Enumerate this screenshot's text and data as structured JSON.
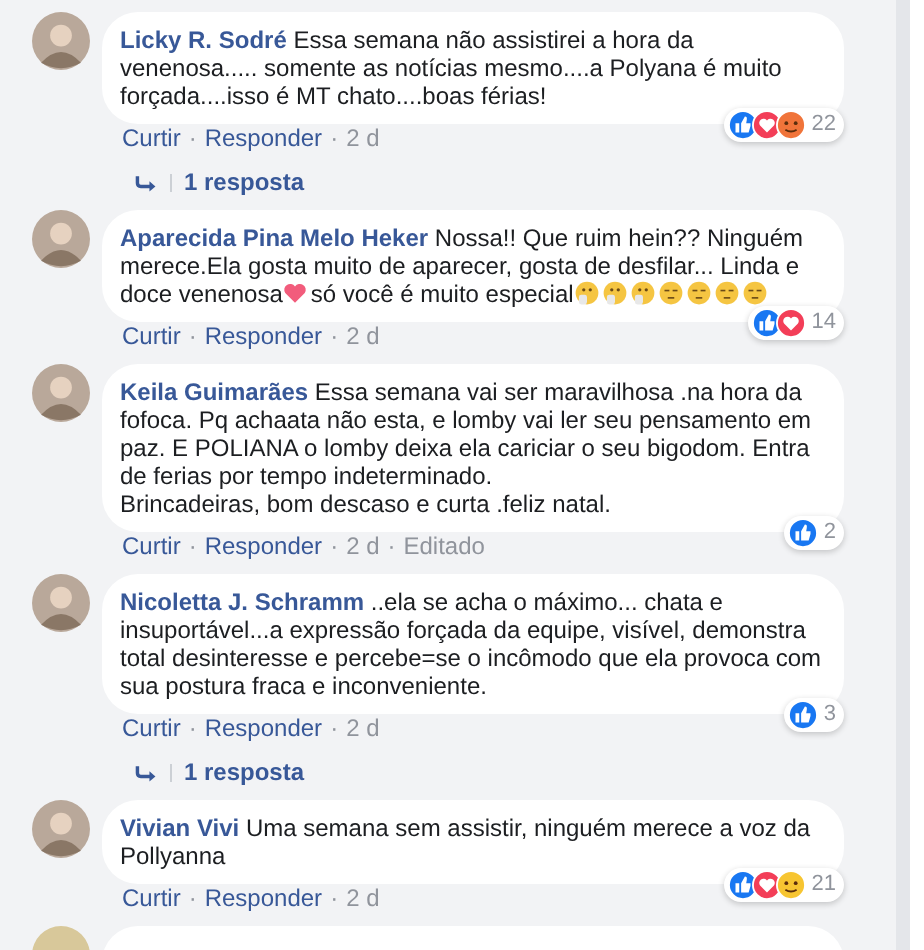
{
  "comments": [
    {
      "kind": "comment",
      "author": "Licky R. Sodré",
      "body": [
        {
          "kind": "text",
          "text": "Essa semana não assistirei a hora da venenosa..... somente as notícias mesmo....a Polyana é muito forçada....isso é MT chato....boas férias!"
        }
      ],
      "meta": [
        {
          "kind": "link",
          "text": "Curtir"
        },
        {
          "kind": "sep",
          "text": "·"
        },
        {
          "kind": "link",
          "text": "Responder"
        },
        {
          "kind": "sep",
          "text": "·"
        },
        {
          "kind": "time",
          "text": "2 d"
        }
      ],
      "reactions": [
        {
          "kind": "like"
        },
        {
          "kind": "love"
        },
        {
          "kind": "angry"
        }
      ],
      "reaction_count": "22",
      "replies": "1 resposta"
    },
    {
      "kind": "comment",
      "author": "Aparecida Pina Melo Heker",
      "body": [
        {
          "kind": "text",
          "text": "Nossa!! Que ruim hein?? Ninguém merece.Ela gosta muito de aparecer, gosta de desfilar... Linda e doce venenosa"
        },
        {
          "kind": "heart"
        },
        {
          "kind": "text",
          "text": "só você é muito especial"
        },
        {
          "kind": "thinking"
        },
        {
          "kind": "thinking"
        },
        {
          "kind": "thinking"
        },
        {
          "kind": "unamused"
        },
        {
          "kind": "unamused"
        },
        {
          "kind": "unamused"
        },
        {
          "kind": "unamused"
        }
      ],
      "meta": [
        {
          "kind": "link",
          "text": "Curtir"
        },
        {
          "kind": "sep",
          "text": "·"
        },
        {
          "kind": "link",
          "text": "Responder"
        },
        {
          "kind": "sep",
          "text": "·"
        },
        {
          "kind": "time",
          "text": "2 d"
        }
      ],
      "reactions": [
        {
          "kind": "like"
        },
        {
          "kind": "love"
        }
      ],
      "reaction_count": "14"
    },
    {
      "kind": "comment",
      "author": "Keila Guimarães",
      "body": [
        {
          "kind": "text",
          "text": "Essa semana vai ser maravilhosa .na hora da fofoca. Pq achaata não esta, e lomby vai ler seu pensamento em paz. E POLIANA o lomby deixa ela cariciar o seu bigodom. Entra de ferias por tempo indeterminado.\nBrincadeiras, bom descaso e curta .feliz natal."
        }
      ],
      "meta": [
        {
          "kind": "link",
          "text": "Curtir"
        },
        {
          "kind": "sep",
          "text": "·"
        },
        {
          "kind": "link",
          "text": "Responder"
        },
        {
          "kind": "sep",
          "text": "·"
        },
        {
          "kind": "time",
          "text": "2 d"
        },
        {
          "kind": "sep",
          "text": "·"
        },
        {
          "kind": "time",
          "text": "Editado"
        }
      ],
      "reactions": [
        {
          "kind": "like"
        }
      ],
      "reaction_count": "2"
    },
    {
      "kind": "comment",
      "author": "Nicoletta J. Schramm",
      "body": [
        {
          "kind": "text",
          "text": "..ela se acha o máximo... chata e insuportável...a expressão forçada da equipe, visível, demonstra total desinteresse e percebe=se o incômodo que ela provoca com sua postura fraca e inconveniente."
        }
      ],
      "meta": [
        {
          "kind": "link",
          "text": "Curtir"
        },
        {
          "kind": "sep",
          "text": "·"
        },
        {
          "kind": "link",
          "text": "Responder"
        },
        {
          "kind": "sep",
          "text": "·"
        },
        {
          "kind": "time",
          "text": "2 d"
        }
      ],
      "reactions": [
        {
          "kind": "like"
        }
      ],
      "reaction_count": "3",
      "replies": "1 resposta"
    },
    {
      "kind": "comment",
      "author": "Vivian Vivi",
      "body": [
        {
          "kind": "text",
          "text": "Uma semana sem assistir, ninguém merece a voz da Pollyanna"
        }
      ],
      "meta": [
        {
          "kind": "link",
          "text": "Curtir"
        },
        {
          "kind": "sep",
          "text": "·"
        },
        {
          "kind": "link",
          "text": "Responder"
        },
        {
          "kind": "sep",
          "text": "·"
        },
        {
          "kind": "time",
          "text": "2 d"
        }
      ],
      "reactions": [
        {
          "kind": "like"
        },
        {
          "kind": "love"
        },
        {
          "kind": "haha"
        }
      ],
      "reaction_count": "21"
    },
    {
      "kind": "cut"
    }
  ]
}
